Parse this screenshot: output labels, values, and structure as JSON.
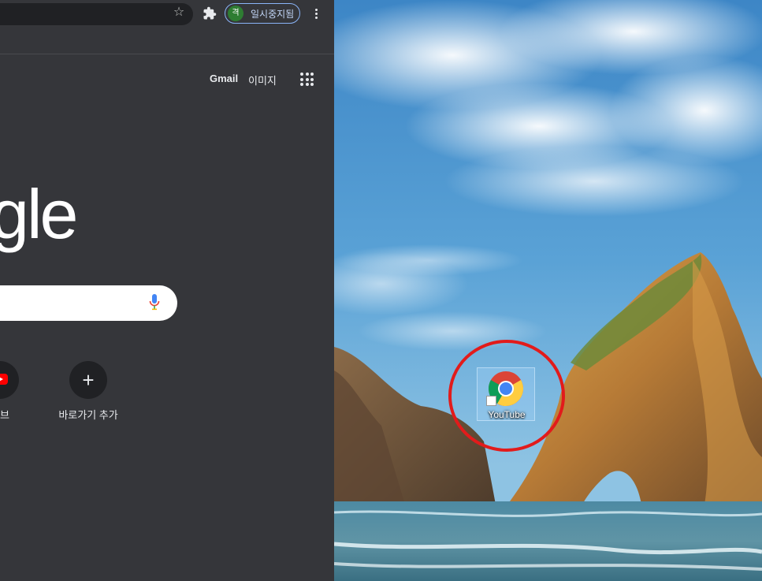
{
  "browser": {
    "toolbar": {
      "profile_avatar_letter": "격",
      "profile_label": "일시중지됨"
    },
    "ntp": {
      "links": {
        "gmail": "Gmail",
        "images": "이미지"
      },
      "logo_text": "gle",
      "shortcuts": [
        {
          "label": "튜브",
          "icon": "youtube-icon"
        },
        {
          "label": "바로가기 추가",
          "icon": "plus-icon"
        }
      ]
    }
  },
  "desktop": {
    "icon": {
      "label": "YouTube",
      "icon": "chrome-icon"
    },
    "highlight_color": "#e21b1b"
  },
  "colors": {
    "browser_bg": "#35363a",
    "omnibox_bg": "#202124",
    "profile_border": "#8ab4f8",
    "avatar_bg": "#2e7d32"
  }
}
